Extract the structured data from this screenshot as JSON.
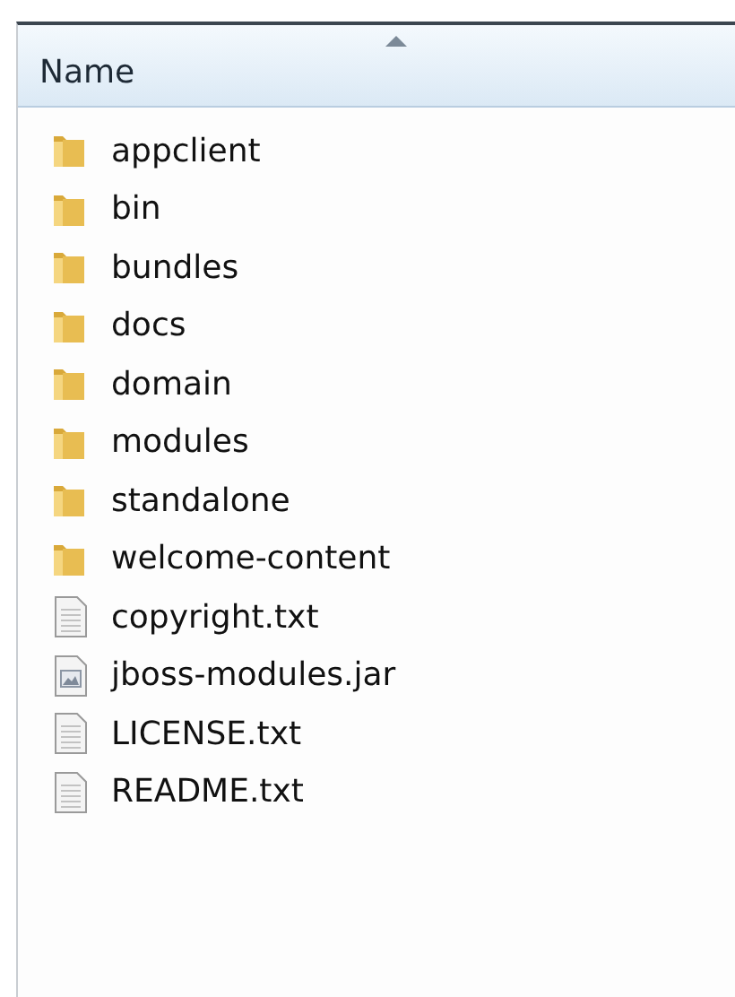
{
  "column_header": {
    "label": "Name"
  },
  "files": [
    {
      "name": "appclient",
      "kind": "folder"
    },
    {
      "name": "bin",
      "kind": "folder"
    },
    {
      "name": "bundles",
      "kind": "folder"
    },
    {
      "name": "docs",
      "kind": "folder"
    },
    {
      "name": "domain",
      "kind": "folder"
    },
    {
      "name": "modules",
      "kind": "folder"
    },
    {
      "name": "standalone",
      "kind": "folder"
    },
    {
      "name": "welcome-content",
      "kind": "folder"
    },
    {
      "name": "copyright.txt",
      "kind": "text"
    },
    {
      "name": "jboss-modules.jar",
      "kind": "jar"
    },
    {
      "name": "LICENSE.txt",
      "kind": "text"
    },
    {
      "name": "README.txt",
      "kind": "text"
    }
  ]
}
